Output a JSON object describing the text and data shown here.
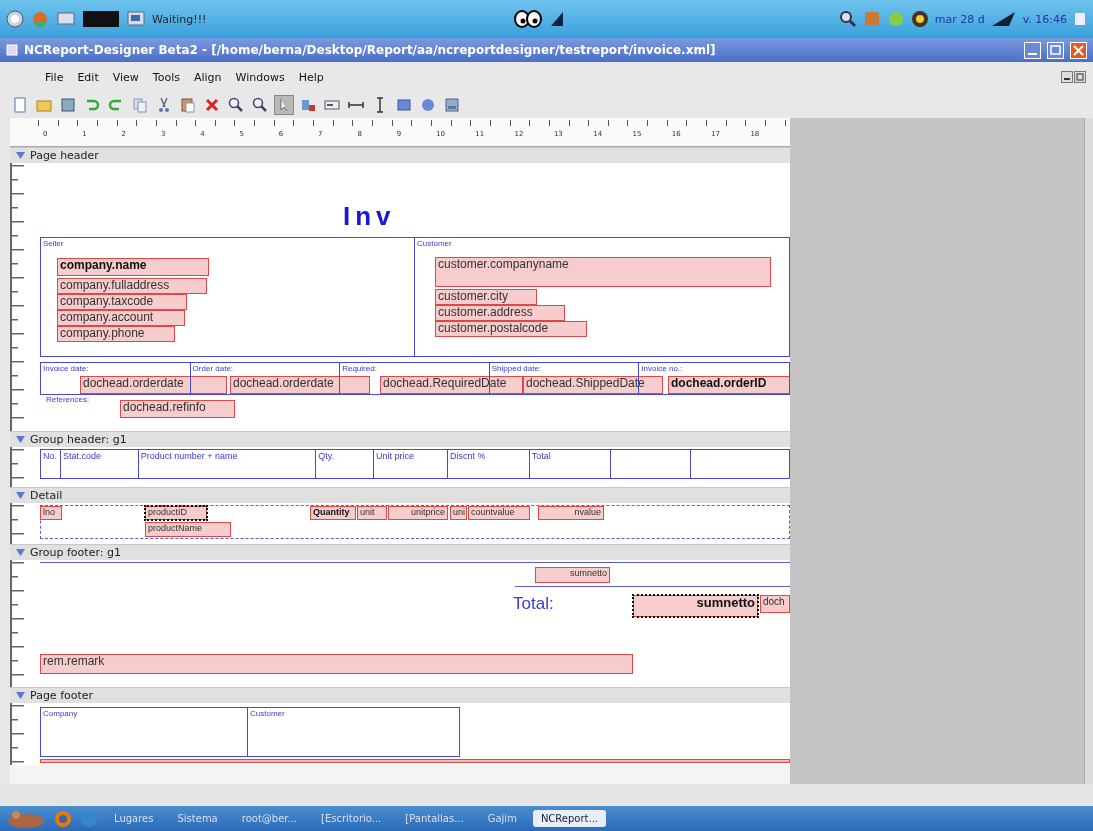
{
  "top_panel": {
    "status_text": "Waiting!!!",
    "clock_start": "mar 28 d",
    "clock_end": "v. 16:46"
  },
  "window": {
    "title": "NCReport-Designer Beta2 - [/home/berna/Desktop/Report/aa/ncreportdesigner/testreport/invoice.xml]"
  },
  "menu": [
    "File",
    "Edit",
    "View",
    "Tools",
    "Align",
    "Windows",
    "Help"
  ],
  "toolbar": [
    {
      "selected": false
    },
    {
      "selected": false
    },
    {
      "selected": false
    },
    {
      "selected": false
    },
    {
      "selected": false
    },
    {
      "selected": false
    },
    {
      "selected": false
    },
    {
      "selected": false
    },
    {
      "selected": false
    },
    {
      "selected": false
    },
    {
      "selected": false
    },
    {
      "selected": true
    },
    {
      "selected": false
    },
    {
      "selected": false
    },
    {
      "selected": false
    },
    {
      "selected": false
    },
    {
      "selected": false
    },
    {
      "selected": false
    },
    {
      "selected": false
    }
  ],
  "ruler": [
    "0",
    "1",
    "2",
    "3",
    "4",
    "5",
    "6",
    "7",
    "8",
    "9",
    "10",
    "11",
    "12",
    "13",
    "14",
    "15",
    "16",
    "17",
    "18"
  ],
  "sections": [
    {
      "title": "Page header",
      "expanded": true,
      "items": [
        {
          "kind": "title",
          "text": "Inv"
        },
        {
          "kind": "field",
          "text": "company.name",
          "bold": true,
          "selected": false
        },
        {
          "kind": "field",
          "text": "company.fulladdress",
          "bold": false,
          "selected": false
        },
        {
          "kind": "field",
          "text": "company.taxcode",
          "bold": false,
          "selected": false
        },
        {
          "kind": "field",
          "text": "company.account",
          "bold": false,
          "selected": false
        },
        {
          "kind": "field",
          "text": "company.phone",
          "bold": false,
          "selected": false
        },
        {
          "kind": "field",
          "text": "customer.companyname",
          "bold": false,
          "selected": false
        },
        {
          "kind": "field",
          "text": "customer.city",
          "bold": false,
          "selected": false
        },
        {
          "kind": "field",
          "text": "customer.address",
          "bold": false,
          "selected": false
        },
        {
          "kind": "field",
          "text": "customer.postalcode",
          "bold": false,
          "selected": false
        },
        {
          "kind": "field",
          "text": "dochead.orderdate",
          "bold": false,
          "selected": false
        },
        {
          "kind": "field",
          "text": "dochead.orderdate",
          "bold": false,
          "selected": false
        },
        {
          "kind": "field",
          "text": "dochead.RequiredDate",
          "bold": false,
          "selected": false
        },
        {
          "kind": "field",
          "text": "dochead.ShippedDate",
          "bold": false,
          "selected": false
        },
        {
          "kind": "field",
          "text": "dochead.orderID",
          "bold": true,
          "selected": false
        },
        {
          "kind": "label",
          "text": "References:"
        },
        {
          "kind": "field",
          "text": "dochead.refinfo",
          "bold": false,
          "selected": false
        },
        {
          "kind": "frame",
          "cells": [
            "Seller",
            "Customer"
          ],
          "selected": false
        },
        {
          "kind": "frame",
          "cells": [
            "Invoice date:",
            "Order date:",
            "Required:",
            "Shipped date:",
            "Invoice no.:"
          ],
          "selected": false
        }
      ]
    },
    {
      "title": "Group header: g1",
      "expanded": true,
      "items": [
        {
          "kind": "frame",
          "cells": [
            "No.",
            "Stat.code",
            "Product number + name",
            "Qty.",
            "Unit price",
            "Discnt %",
            "Total",
            "",
            ""
          ],
          "selected": false
        }
      ]
    },
    {
      "title": "Detail",
      "expanded": true,
      "items": [
        {
          "kind": "field",
          "text": "lno",
          "bold": false,
          "selected": false
        },
        {
          "kind": "field",
          "text": "productID",
          "bold": false,
          "selected": true
        },
        {
          "kind": "field",
          "text": "productName",
          "bold": false,
          "selected": false
        },
        {
          "kind": "field",
          "text": "Quantity",
          "bold": true,
          "selected": false
        },
        {
          "kind": "field",
          "text": "unit",
          "bold": false,
          "selected": false
        },
        {
          "kind": "field",
          "text": "unitprice",
          "bold": false,
          "selected": false
        },
        {
          "kind": "field",
          "text": "uni",
          "bold": false,
          "selected": false
        },
        {
          "kind": "field",
          "text": "countvalue",
          "bold": false,
          "selected": false
        },
        {
          "kind": "field",
          "text": "nvalue",
          "bold": false,
          "selected": false
        }
      ]
    },
    {
      "title": "Group footer: g1",
      "expanded": true,
      "items": [
        {
          "kind": "line"
        },
        {
          "kind": "field",
          "text": "sumnetto",
          "bold": false,
          "selected": false
        },
        {
          "kind": "line"
        },
        {
          "kind": "title",
          "text": "Total:"
        },
        {
          "kind": "field",
          "text": "sumnetto",
          "bold": true,
          "selected": true
        },
        {
          "kind": "field",
          "text": "doch",
          "bold": false,
          "selected": false
        },
        {
          "kind": "field",
          "text": "rem.remark",
          "bold": false,
          "selected": false
        }
      ]
    },
    {
      "title": "Page footer",
      "expanded": true,
      "items": [
        {
          "kind": "frame",
          "cells": [
            "Company",
            "Customer"
          ],
          "selected": false
        },
        {
          "kind": "bar",
          "selected": false
        }
      ]
    }
  ],
  "taskbar": [
    {
      "label": "Lugares",
      "active": false
    },
    {
      "label": "Sistema",
      "active": false
    },
    {
      "label": "root@ber...",
      "active": false
    },
    {
      "label": "[Escritorio...",
      "active": false
    },
    {
      "label": "[Pantallas...",
      "active": false
    },
    {
      "label": "Gajim",
      "active": false
    },
    {
      "label": "NCReport...",
      "active": true
    }
  ]
}
